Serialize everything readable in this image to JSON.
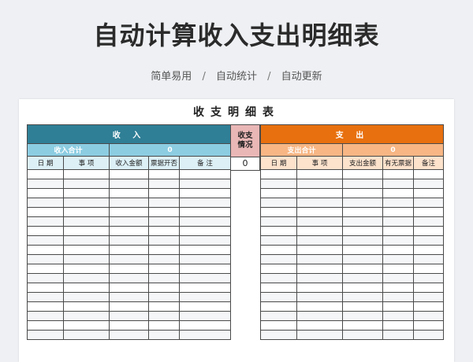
{
  "page_title": "自动计算收入支出明细表",
  "tags": [
    "简单易用",
    "自动统计",
    "自动更新"
  ],
  "tag_separator": "/",
  "sheet_title": "收支明细表",
  "income": {
    "header": "收 入",
    "total_label": "收入合计",
    "total_value": "0",
    "columns": [
      "日 期",
      "事 项",
      "收入金额",
      "票据开否",
      "备 注"
    ]
  },
  "status": {
    "label_line1": "收支",
    "label_line2": "情况",
    "value": "0"
  },
  "expense": {
    "header": "支 出",
    "total_label": "支出合计",
    "total_value": "0",
    "columns": [
      "日 期",
      "事 项",
      "支出金额",
      "有无票据",
      "备注"
    ]
  },
  "colors": {
    "income_header": "#2f7f96",
    "income_subheader": "#8ccde2",
    "expense_header": "#e8700e",
    "expense_subheader": "#f7b684",
    "status_label": "#e9b7b6"
  }
}
